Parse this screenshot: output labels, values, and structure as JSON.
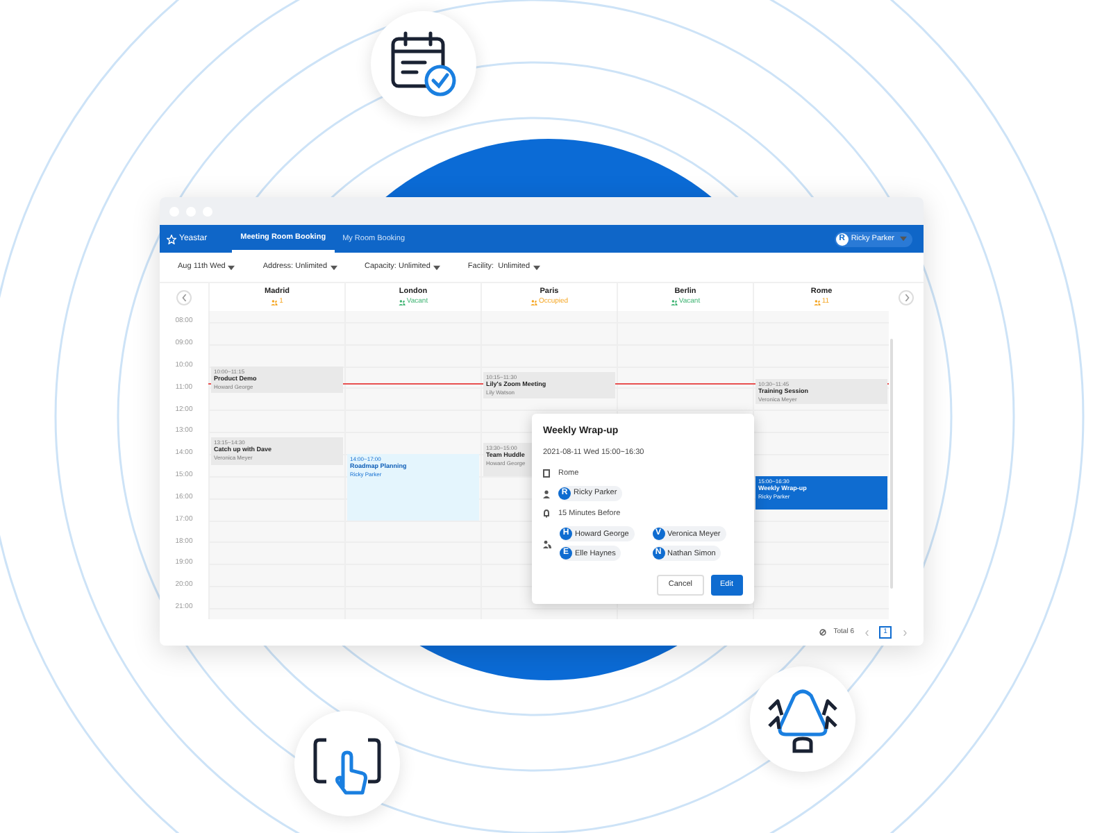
{
  "app": {
    "logo": "Yeastar",
    "tabs": [
      {
        "label": "Meeting Room Booking",
        "selected": true
      },
      {
        "label": "My Room Booking",
        "selected": false
      }
    ],
    "user": {
      "initial": "R",
      "name": "Ricky Parker"
    }
  },
  "filters": [
    "Aug 11th Wed",
    "Address: Unlimited",
    "Capacity: Unlimited",
    "Facility:  Unlimited"
  ],
  "rooms": [
    {
      "name": "Madrid",
      "status": "1",
      "color": "#f5a623",
      "events": [
        {
          "time": "10:00~11:15",
          "title": "Product Demo",
          "person": "Howard George",
          "kind": "busy"
        },
        {
          "time": "13:15~14:30",
          "title": "Catch up with Dave",
          "person": "Veronica Meyer",
          "kind": "busy"
        }
      ]
    },
    {
      "name": "London",
      "status": "Vacant",
      "color": "#3cb371",
      "events": [
        {
          "time": "14:00~17:00",
          "title": "Roadmap Planning",
          "person": "Ricky Parker",
          "kind": "mine"
        }
      ]
    },
    {
      "name": "Paris",
      "status": "Occupied",
      "color": "#f5a623",
      "events": [
        {
          "time": "10:15~11:30",
          "title": "Lily's Zoom Meeting",
          "person": "Lily Watson",
          "kind": "busy"
        },
        {
          "time": "13:30~15:00",
          "title": "Team Huddle",
          "person": "Howard George",
          "kind": "busy"
        }
      ]
    },
    {
      "name": "Berlin",
      "status": "Vacant",
      "color": "#3cb371"
    },
    {
      "name": "Rome",
      "status": "11",
      "color": "#f5a623",
      "events": [
        {
          "time": "10:30~11:45",
          "title": "Training Session",
          "person": "Veronica Meyer",
          "kind": "busy"
        },
        {
          "time": "15:00~16:30",
          "title": "Weekly Wrap-up",
          "person": "Ricky Parker",
          "kind": "selected"
        }
      ]
    }
  ],
  "hours": [
    "08:00",
    "09:00",
    "10:00",
    "11:00",
    "12:00",
    "13:00",
    "14:00",
    "15:00",
    "16:00",
    "17:00",
    "18:00",
    "19:00",
    "20:00",
    "21:00"
  ],
  "popover": {
    "title": "Weekly Wrap-up",
    "when": "2021-08-11 Wed 15:00~16:30",
    "room": "Rome",
    "organizer": {
      "initial": "R",
      "name": "Ricky Parker"
    },
    "reminder": "15 Minutes Before",
    "attendees": [
      {
        "initial": "H",
        "name": "Howard George"
      },
      {
        "initial": "V",
        "name": "Veronica Meyer"
      },
      {
        "initial": "E",
        "name": "Elle Haynes"
      },
      {
        "initial": "N",
        "name": "Nathan Simon"
      }
    ],
    "buttons": [
      "Cancel",
      "Edit"
    ]
  },
  "footer": {
    "total": "Total 6",
    "page": "1"
  }
}
